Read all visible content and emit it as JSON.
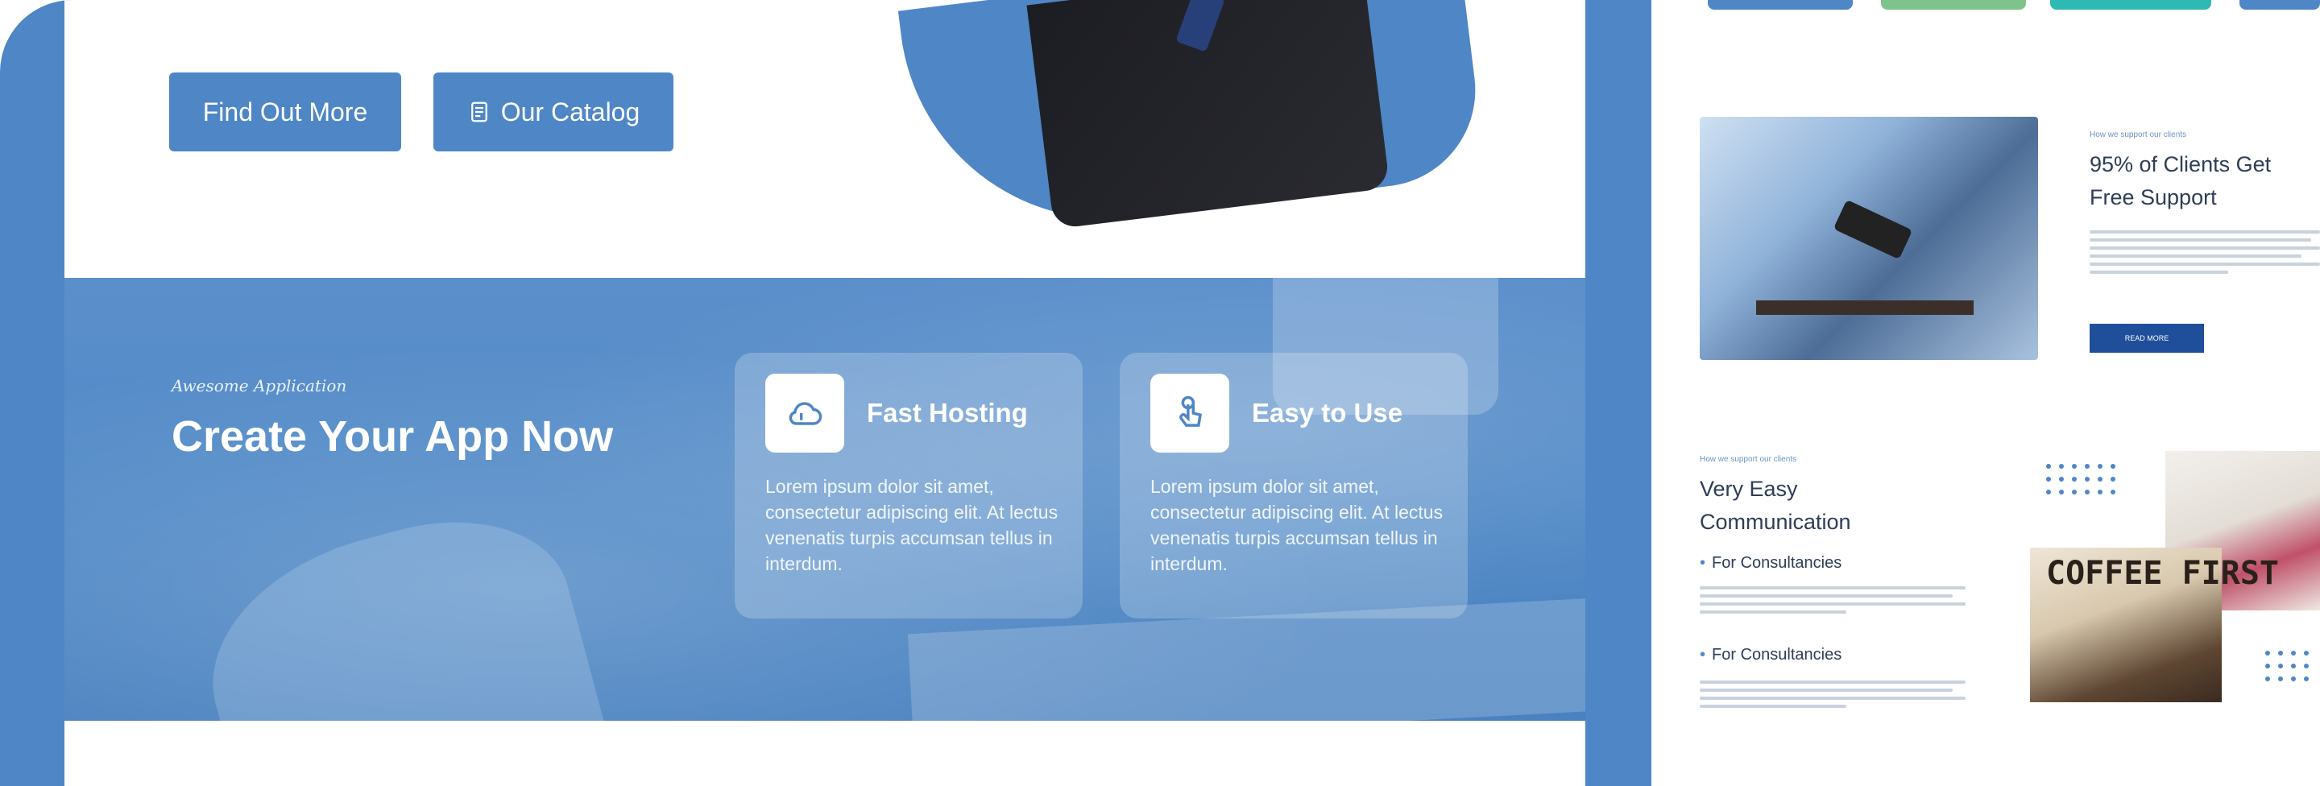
{
  "colors": {
    "brand_blue": "#4e86c6",
    "navy_button": "#1f4f9a",
    "tab_green": "#7dc38b",
    "tab_teal": "#2fb9b3",
    "text_dark": "#2e3d57"
  },
  "hero": {
    "find_out_more": "Find Out More",
    "our_catalog": "Our Catalog",
    "catalog_icon": "document-icon"
  },
  "banner": {
    "kicker": "Awesome Application",
    "title": "Create Your App Now",
    "features": [
      {
        "icon": "cloud-icon",
        "title": "Fast Hosting",
        "desc": "Lorem ipsum dolor sit amet, consectetur adipiscing elit. At lectus venenatis turpis accumsan tellus in interdum."
      },
      {
        "icon": "hand-tap-icon",
        "title": "Easy to Use",
        "desc": "Lorem ipsum dolor sit amet, consectetur adipiscing elit. At lectus venenatis turpis accumsan tellus in interdum."
      }
    ]
  },
  "right_preview": {
    "support": {
      "kicker": "How we support our clients",
      "heading": "95% of Clients Get Free Support",
      "button": "READ MORE"
    },
    "communication": {
      "kicker": "How we support our clients",
      "heading": "Very Easy Communication",
      "bullets": [
        "For Consultancies",
        "For Consultancies"
      ]
    },
    "coffee_sign": "COFFEE FIRST"
  }
}
